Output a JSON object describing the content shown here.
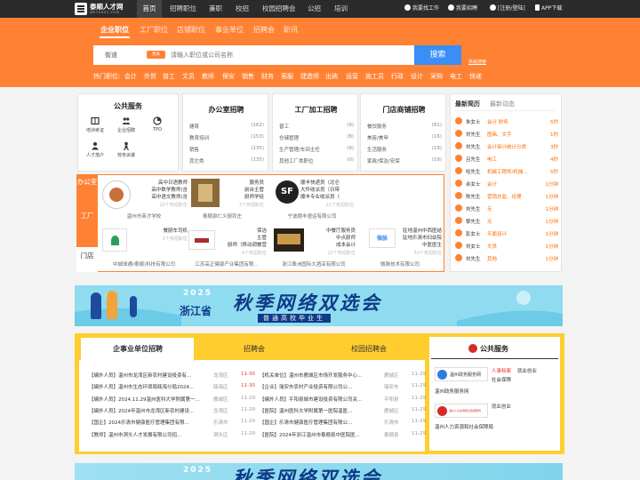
{
  "site": {
    "logo_name": "泰顺人才网",
    "logo_sub": "WETHRSC.COM"
  },
  "nav": [
    {
      "label": "首页"
    },
    {
      "label": "招聘职位"
    },
    {
      "label": "兼职"
    },
    {
      "label": "校招"
    },
    {
      "label": "校园招聘会"
    },
    {
      "label": "公招"
    },
    {
      "label": "培训"
    }
  ],
  "toplinks": {
    "find_job": "我要找工作",
    "recruit": "我要招聘",
    "login": "[注册/登陆]",
    "app": "APP下载"
  },
  "subtabs": [
    "企业职位",
    "工厂职位",
    "店铺职位",
    "事业单位",
    "招聘会",
    "职讯"
  ],
  "search": {
    "city": "街道",
    "tag": "更多",
    "placeholder": "请输入职位或公司名称",
    "button": "搜索",
    "advanced": "高级搜索"
  },
  "hot": {
    "label": "热门职位:",
    "items": [
      "会计",
      "外贸",
      "普工",
      "文员",
      "教师",
      "保安",
      "销售",
      "财务",
      "客服",
      "建造师",
      "出纳",
      "运营",
      "施工员",
      "行政",
      "设计",
      "采购",
      "电工",
      "快递"
    ]
  },
  "public_service": {
    "title": "公共服务",
    "items": [
      {
        "label": "培训考证",
        "icon": "book-icon"
      },
      {
        "label": "企业招聘",
        "icon": "people-icon"
      },
      {
        "label": "TPO",
        "icon": "chart-icon"
      },
      {
        "label": "人才落户",
        "icon": "person-icon"
      },
      {
        "label": "劳务派遣",
        "icon": "worker-icon"
      }
    ]
  },
  "categories": [
    {
      "title": "办公室招聘",
      "rows": [
        {
          "name": "建筑",
          "count": "(162)"
        },
        {
          "name": "教育培训",
          "count": "(153)"
        },
        {
          "name": "销售",
          "count": "(135)"
        },
        {
          "name": "其它类",
          "count": "(135)"
        }
      ]
    },
    {
      "title": "工厂加工招聘",
      "rows": [
        {
          "name": "普工",
          "count": "(9)"
        },
        {
          "name": "仓储管理",
          "count": "(8)"
        },
        {
          "name": "生产管理/车间主任",
          "count": "(9)"
        },
        {
          "name": "其他工厂类职位",
          "count": "(0)"
        }
      ]
    },
    {
      "title": "门店商铺招聘",
      "rows": [
        {
          "name": "餐饮服务",
          "count": "(81)"
        },
        {
          "name": "美容/美甲",
          "count": "(16)"
        },
        {
          "name": "生活服务",
          "count": "(18)"
        },
        {
          "name": "家政/保洁/安保",
          "count": "(18)"
        }
      ]
    }
  ],
  "featured": {
    "side_tabs": [
      "办公室",
      "工厂",
      "门店"
    ],
    "cards": [
      {
        "lines": [
          "高中日语教师",
          "高中数学教师(含",
          "高中语文教师(含"
        ],
        "more": "20个热招职位",
        "company": "温州市英才学校"
      },
      {
        "lines": [
          "服务员",
          "前台主管",
          "厨师学徒"
        ],
        "more": "3个热招职位",
        "company": "泰顺县仁义厨农庄"
      },
      {
        "lines": [
          "顺丰快递员（北仑",
          "大件收派员（日带",
          "顺丰专业收派员（"
        ],
        "more": "21个热招职位",
        "company": "宁波顺丰速运有限公司"
      },
      {
        "lines": [
          "餐厨车司机"
        ],
        "more": "1个热招职位",
        "company": "中城球通(泰顺)科技有限公司"
      },
      {
        "lines": [
          "保洁",
          "主管",
          "厨师（移动调餐营"
        ],
        "more": "4个热招职位",
        "company": "江苏高正健康产业集团有限..."
      },
      {
        "lines": [
          "中餐厅服务员",
          "中点厨师",
          "成本会计"
        ],
        "more": "22个热招职位",
        "company": "浙江泰洲国际大酒店有限公司"
      },
      {
        "lines": [
          "驻地温州中西医结",
          "驻地乐清市妇幼院",
          "中医医生"
        ],
        "more": "53个热招职位",
        "company": "微脉技术有限公司"
      }
    ]
  },
  "right_list": {
    "tabs": [
      "最新简历",
      "最新动态"
    ],
    "rows": [
      {
        "name": "朱女士",
        "job": "会计 财务",
        "time": "5秒"
      },
      {
        "name": "刘先生",
        "job": "图画、文手",
        "time": "1秒"
      },
      {
        "name": "刘先生",
        "job": "会计审计统计分类",
        "time": "3秒"
      },
      {
        "name": "吕先生",
        "job": "电工",
        "time": "4秒"
      },
      {
        "name": "哈先生",
        "job": "机械工程师/机械...",
        "time": "5秒"
      },
      {
        "name": "余女士",
        "job": "会计",
        "time": "1分钟"
      },
      {
        "name": "陈先生",
        "job": "营销总监、经理",
        "time": "1分钟"
      },
      {
        "name": "刘先生",
        "job": "无",
        "time": "1分钟"
      },
      {
        "name": "黎先生",
        "job": "无",
        "time": "1分钟"
      },
      {
        "name": "彭女士",
        "job": "平面设计",
        "time": "1分钟"
      },
      {
        "name": "刘女士",
        "job": "文员",
        "time": "1分钟"
      },
      {
        "name": "刘先生",
        "job": "其他",
        "time": "1分钟"
      }
    ]
  },
  "banner": {
    "year": "2025",
    "province": "浙江省",
    "main": "秋季网络双选会",
    "sub": "普通高校毕业生"
  },
  "bottom": {
    "tabs": [
      "企事业单位招聘",
      "招聘会",
      "校园招聘会"
    ],
    "left_jobs": [
      {
        "title": "【编外人员】温州市龙湾区新农村建设投资有...",
        "loc": "龙湾区",
        "date": "11-30",
        "red": true
      },
      {
        "title": "【编外人员】温州市生态环境局瓯海分局2024...",
        "loc": "瓯海区",
        "date": "11-30",
        "red": true
      },
      {
        "title": "【编外人员】2024.11.29温州医科大学附属第一...",
        "loc": "鹿城区",
        "date": "11-29",
        "red": false
      },
      {
        "title": "【编外人员】2024年温州市龙湾区新农村建设...",
        "loc": "龙湾区",
        "date": "11-29",
        "red": false
      },
      {
        "title": "【国企】2024乐清市健康医疗管理集团有限...",
        "loc": "乐清市",
        "date": "11-29",
        "red": false
      },
      {
        "title": "【教师】温州市洞头人才发展有限公司招...",
        "loc": "洞头区",
        "date": "11-29",
        "red": false
      }
    ],
    "right_jobs": [
      {
        "title": "【机关单位】温州市鹿城区市场开发服务中心...",
        "loc": "鹿城区",
        "date": "11-29"
      },
      {
        "title": "【企业】瑞安市农村产业投资有限公司公...",
        "loc": "瑞安市",
        "date": "11-29"
      },
      {
        "title": "【编外人员】平阳县城市建设投资有限公司关...",
        "loc": "平阳县",
        "date": "11-29"
      },
      {
        "title": "【医院】温州医科大学附属第一医院温医...",
        "loc": "鹿城区",
        "date": "11-29"
      },
      {
        "title": "【国企】乐清市健康医疗管理集团有限公...",
        "loc": "乐清市",
        "date": "11-29"
      },
      {
        "title": "【医院】2024年浙江温州市泰顺县中医院医...",
        "loc": "泰顺县",
        "date": "11-29"
      }
    ]
  },
  "public_service2": {
    "title": "公共服务",
    "items": [
      {
        "logo": "温州政务服务网",
        "tags": [
          "人事档案",
          "就业创业",
          "社会保障"
        ],
        "caption": "温州政务服务网"
      },
      {
        "logo": "温州人力资源和社会保障局",
        "tags": [
          "就业创业"
        ],
        "caption": "温州人力资源和社会保障局"
      }
    ]
  },
  "colors": {
    "orange": "#ff8234",
    "dark": "#2b2b2b",
    "blue": "#3a8ef6",
    "yellow": "#ffcd2e"
  }
}
